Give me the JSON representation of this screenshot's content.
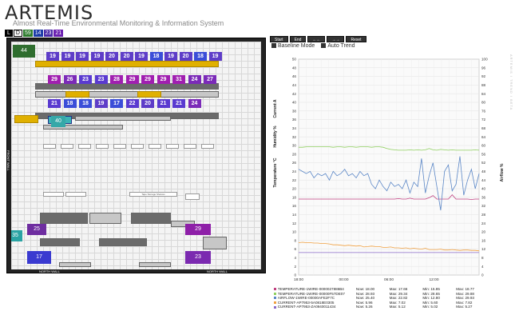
{
  "app": {
    "title": "ARTEMIS",
    "subtitle": "Almost Real-Time Environmental Monitoring & Information System"
  },
  "modebar": {
    "mode_buttons": [
      "L",
      "D"
    ],
    "counts": [
      {
        "value": "59",
        "color": "#2e7d2e"
      },
      {
        "value": "14",
        "color": "#1c3ca8"
      },
      {
        "value": "23",
        "color": "#4b2aa8"
      },
      {
        "value": "21",
        "color": "#6a1fb0"
      }
    ]
  },
  "floorplan": {
    "left_wall_label": "FRONT WALL",
    "bottom_wall_labels": [
      "NORTH WALL",
      "NORTH WALL"
    ],
    "row_labels": [
      "Vertical/Backup",
      "Temperature monitoring",
      "Vertical/Backup"
    ],
    "tiles_row1": [
      "19",
      "19",
      "19",
      "19",
      "20",
      "20",
      "19",
      "18",
      "19",
      "20",
      "18",
      "19"
    ],
    "tiles_row2": [
      "29",
      "26",
      "23",
      "23",
      "28",
      "29",
      "29",
      "29",
      "31",
      "24",
      "27"
    ],
    "tiles_row3": [
      "21",
      "18",
      "18",
      "19",
      "17",
      "22",
      "20",
      "21",
      "21",
      "24"
    ],
    "badges": [
      {
        "value": "44",
        "color": "#2f6e2f"
      },
      {
        "value": "40",
        "color": "#36a8a8"
      },
      {
        "value": "35",
        "color": "#2aa4a4"
      },
      {
        "value": "25",
        "color": "#6e2da0"
      },
      {
        "value": "29",
        "color": "#8e1fa8"
      },
      {
        "value": "17",
        "color": "#3a3ad0"
      },
      {
        "value": "23",
        "color": "#7b2ab0"
      }
    ],
    "tape_note": "Tape Storage Shelves"
  },
  "controls": {
    "buttons": [
      "Start",
      "End",
      "←←",
      "→→",
      "Reset"
    ],
    "baseline_label": "Baseline Mode",
    "autotrend_label": "Auto Trend"
  },
  "chart_data": {
    "type": "line",
    "y_left_label": "Temperature °C",
    "y_left_label2": "Humidity %",
    "y_left_label3": "Current A",
    "y_right_label": "Airflow %",
    "y_left_ticks": [
      0,
      2,
      4,
      6,
      8,
      10,
      12,
      14,
      16,
      18,
      20,
      22,
      24,
      26,
      28,
      30,
      32,
      34,
      36,
      38,
      40,
      42,
      44,
      46,
      48,
      50
    ],
    "y_right_ticks": [
      0,
      4,
      8,
      12,
      16,
      20,
      24,
      28,
      32,
      36,
      40,
      44,
      48,
      52,
      56,
      60,
      64,
      68,
      72,
      76,
      80,
      84,
      88,
      92,
      96,
      100
    ],
    "ylim_left": [
      0,
      50
    ],
    "ylim_right": [
      0,
      100
    ],
    "x_ticks": [
      "18:00",
      "00:00",
      "06:00",
      "12:00"
    ],
    "series": [
      {
        "name": "TEMPERATURE-1WIRE-0000027886B4",
        "color": "#c04080",
        "axis": "left",
        "values": [
          17.6,
          17.6,
          17.6,
          17.6,
          17.6,
          17.6,
          17.6,
          17.6,
          17.6,
          17.6,
          17.6,
          17.6,
          17.6,
          17.6,
          17.6,
          17.6,
          17.6,
          17.6,
          17.6,
          17.6,
          17.6,
          17.6,
          17.6,
          17.6,
          17.6,
          17.6,
          17.7,
          17.6,
          17.6,
          17.8,
          17.6,
          17.6,
          17.6,
          17.6,
          17.9,
          18.4,
          17.6,
          17.6,
          17.6,
          17.6,
          18.6,
          17.6,
          17.6,
          17.6,
          17.6,
          17.5,
          17.6,
          17.6
        ]
      },
      {
        "name": "TEMPERATURE-1WIRE-00000F57DE07",
        "color": "#8fcf5f",
        "axis": "left",
        "values": [
          29.6,
          29.6,
          29.7,
          29.7,
          29.7,
          29.7,
          29.7,
          29.7,
          29.7,
          29.6,
          29.7,
          29.7,
          29.6,
          29.7,
          29.7,
          29.6,
          29.7,
          29.7,
          29.7,
          29.6,
          29.7,
          29.7,
          29.6,
          29.3,
          29.1,
          29.0,
          28.9,
          28.9,
          28.9,
          29.0,
          28.9,
          29.0,
          28.9,
          29.0,
          29.3,
          29.0,
          28.9,
          29.1,
          29.0,
          28.9,
          29.0,
          28.9,
          28.9,
          28.9,
          28.9,
          28.9,
          29.0,
          28.9
        ]
      },
      {
        "name": "AIRFLOW-1WIRE-00000AFE2F7C",
        "color": "#5a86c6",
        "axis": "right",
        "values": [
          49,
          48,
          47,
          48,
          45,
          47,
          46,
          47,
          44,
          48,
          46,
          47,
          49,
          46,
          47,
          45,
          48,
          46,
          47,
          42,
          40,
          44,
          41,
          39,
          43,
          41,
          42,
          40,
          44,
          38,
          43,
          41,
          54,
          38,
          46,
          52,
          41,
          30,
          48,
          51,
          39,
          42,
          55,
          37,
          44,
          49,
          40,
          47
        ]
      },
      {
        "name": "CURRENT-AP7953-5A0818E0305",
        "color": "#f0a040",
        "axis": "left",
        "values": [
          7.5,
          7.6,
          7.5,
          7.5,
          7.4,
          7.4,
          7.3,
          7.3,
          7.2,
          7.0,
          7.0,
          6.9,
          6.8,
          6.9,
          6.8,
          6.7,
          6.8,
          6.5,
          6.6,
          6.7,
          6.6,
          6.6,
          6.4,
          6.4,
          6.5,
          6.3,
          6.3,
          6.2,
          6.3,
          6.1,
          6.2,
          6.1,
          6.0,
          6.2,
          5.9,
          5.9,
          5.9,
          6.0,
          5.8,
          5.8,
          5.9,
          5.8,
          5.7,
          5.8,
          5.8,
          5.7,
          5.7,
          5.6
        ]
      },
      {
        "name": "CURRENT-AP7953-ZA0940011434",
        "color": "#8a6ac8",
        "axis": "left",
        "values": [
          5.2,
          5.2,
          5.2,
          5.2,
          5.2,
          5.2,
          5.2,
          5.2,
          5.2,
          5.2,
          5.2,
          5.2,
          5.2,
          5.2,
          5.2,
          5.2,
          5.2,
          5.2,
          5.2,
          5.2,
          5.2,
          5.2,
          5.2,
          5.2,
          5.2,
          5.2,
          5.2,
          5.2,
          5.2,
          5.2,
          5.2,
          5.2,
          5.2,
          5.2,
          5.2,
          5.2,
          5.2,
          5.2,
          5.2,
          5.2,
          5.2,
          5.2,
          5.2,
          5.2,
          5.2,
          5.2,
          5.2,
          5.2
        ]
      }
    ]
  },
  "legend": {
    "header": [
      "Now:",
      "Max:",
      "Min:",
      "Max:"
    ],
    "rows": [
      {
        "name": "TEMPERATURE-1WIRE-0000027886B4",
        "color": "#c04080",
        "now": "Now: 18.00",
        "max": "Max: 17.66",
        "min": "Min: 15.85",
        "max2": "Max: 18.77"
      },
      {
        "name": "TEMPERATURE-1WIRE-00000F57DE07",
        "color": "#8fcf5f",
        "now": "Now: 28.93",
        "max": "Max: 29.34",
        "min": "Min: 28.65",
        "max2": "Max: 29.88"
      },
      {
        "name": "AIRFLOW-1WIRE-00000AFE2F7C",
        "color": "#5a86c6",
        "now": "Now: 25.40",
        "max": "Max: 22.82",
        "min": "Min: 12.80",
        "max2": "Max: 29.93"
      },
      {
        "name": "CURRENT-AP7953-5A0818E0305",
        "color": "#f0a040",
        "now": "Now: 5.96",
        "max": "Max: 7.02",
        "min": "Min: 5.60",
        "max2": "Max: 7.82"
      },
      {
        "name": "CURRENT-AP7953-ZA0940011434",
        "color": "#8a6ac8",
        "now": "Now: 5.26",
        "max": "Max: 5.12",
        "min": "Min: 5.02",
        "max2": "Max: 5.27"
      }
    ]
  },
  "side_tab": "ARTEMIS / TREND / BETA"
}
